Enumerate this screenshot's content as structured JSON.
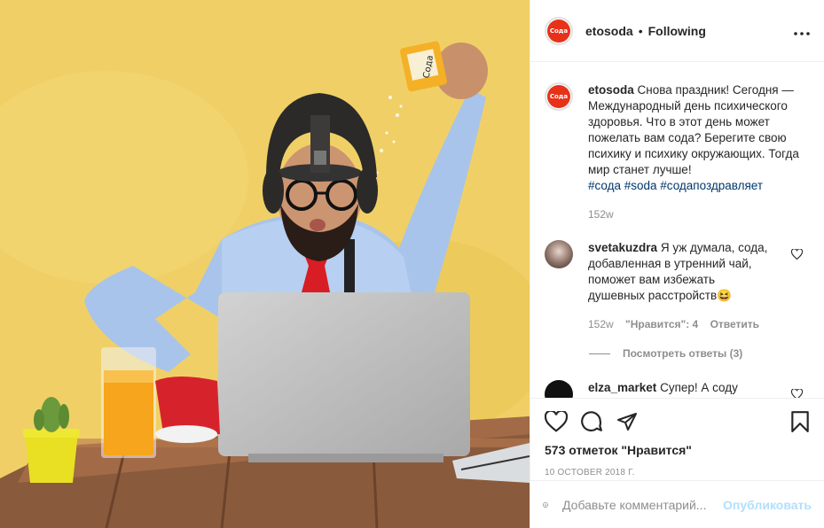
{
  "post": {
    "author": "etosoda",
    "logo_text": "Сода",
    "follow_separator": "•",
    "follow_status": "Following",
    "more_label": "•••",
    "caption": {
      "username": "etosoda",
      "text": "Снова праздник! Сегодня — Международный день психического здоровья. Что в этот день может пожелать вам сода? Берегите свою психику и психику окружающих. Тогда мир станет лучше!",
      "hashtags": "#сода #soda #содапоздравляет",
      "time": "152w"
    },
    "comments": [
      {
        "username": "svetakuzdra",
        "text": "Я уж думала, сода, добавленная в утренний чай, поможет вам избежать душевных расстройств😆",
        "time": "152w",
        "likes_label": "\"Нравится\": 4",
        "reply_label": "Ответить",
        "view_replies": "Посмотреть ответы (3)"
      },
      {
        "username": "elza_market",
        "text": "Супер! А соду"
      }
    ],
    "likes_text": "573 отметок \"Нравится\"",
    "date": "10 OCTOBER 2018 Г.",
    "add_comment_placeholder": "Добавьте комментарий...",
    "publish_label": "Опубликовать"
  },
  "icons": {
    "heart": "heart-icon",
    "comment": "comment-icon",
    "share": "share-icon",
    "bookmark": "bookmark-icon",
    "emoji": "emoji-icon",
    "more": "more-icon"
  },
  "colors": {
    "background_photo": "#efcd5f",
    "link": "#00376b",
    "muted": "#8e8e8e",
    "publish_disabled": "#b2dffc",
    "brand_red": "#e63219"
  }
}
